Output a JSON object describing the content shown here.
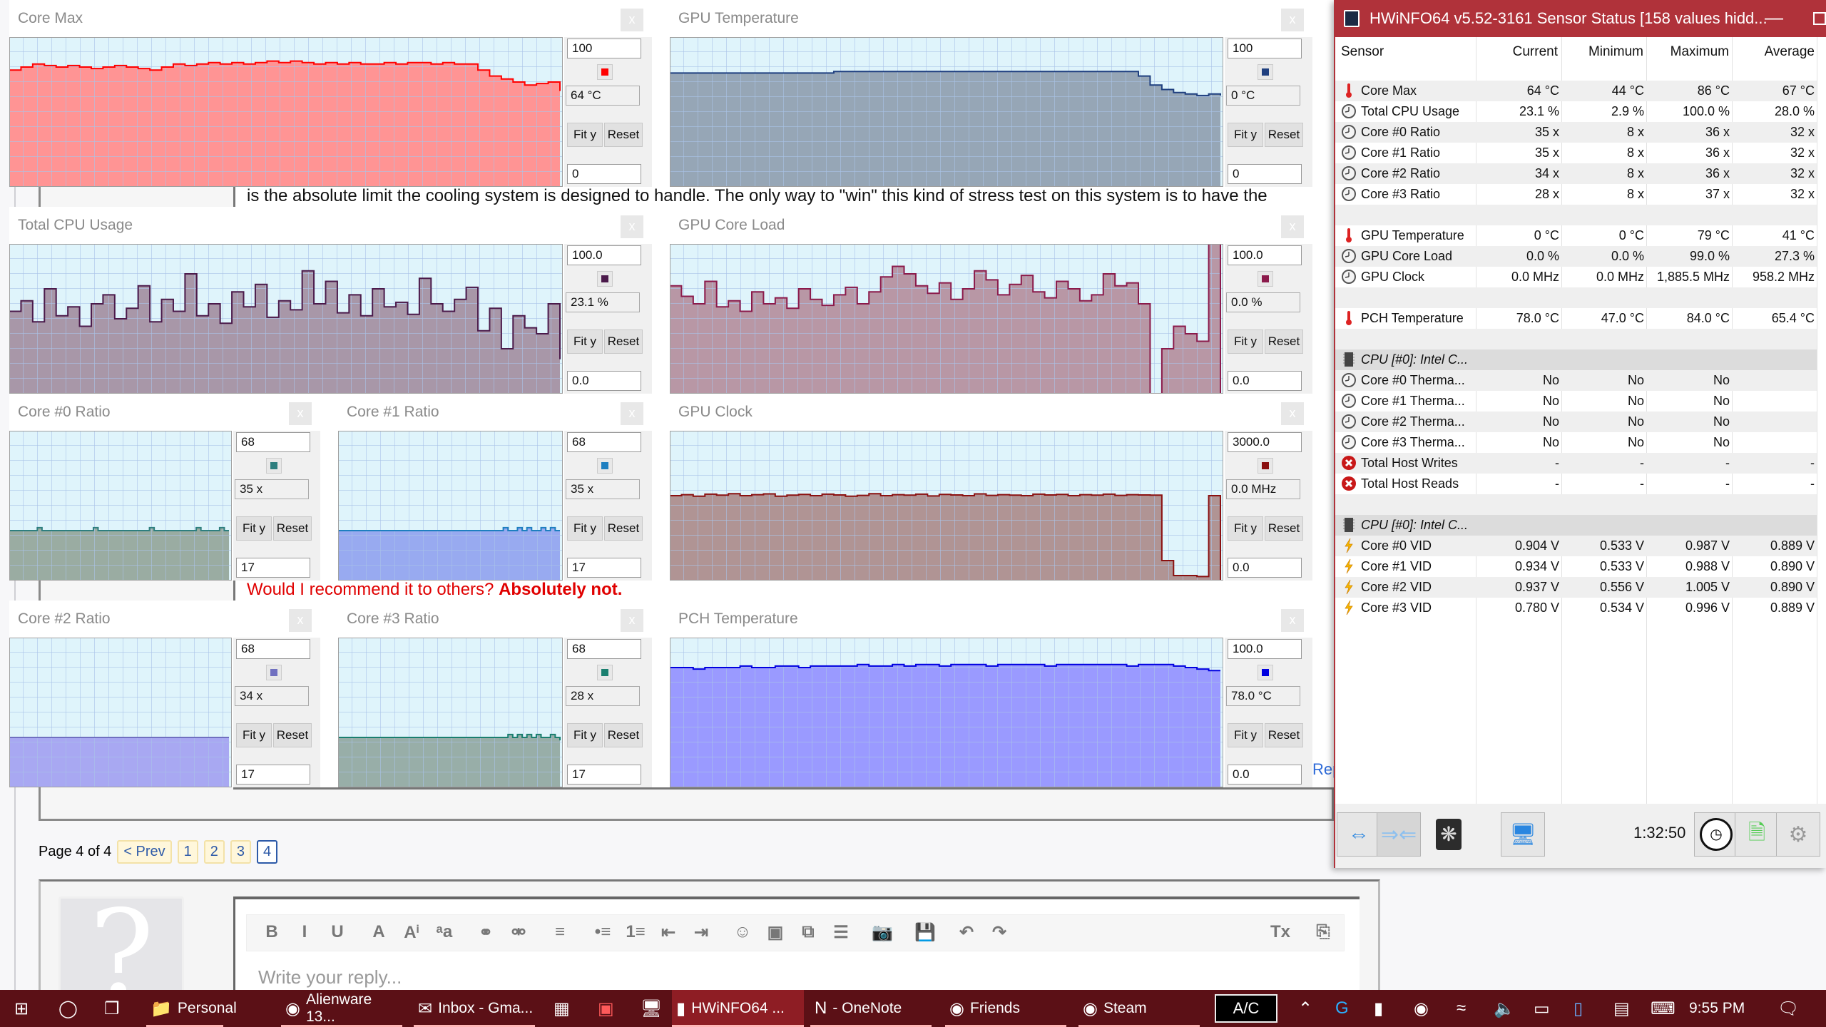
{
  "forum": {
    "line_partial": "is the absolute limit the cooling system is designed to handle. The only way to \"win\" this kind of stress test on this system is to have the",
    "recommend_prefix": "Would I recommend it to others? ",
    "recommend_bold": "Absolutely not.",
    "report_link": "Rep",
    "paging": {
      "label": "Page 4 of 4",
      "prev": "< Prev",
      "pages": [
        "1",
        "2",
        "3",
        "4"
      ],
      "current": "4"
    },
    "reply_placeholder": "Write your reply...",
    "avatar_glyph": "?",
    "editor_tools": [
      "B",
      "I",
      "U",
      "A",
      "Aⁱ",
      "ᵃa",
      "⚭",
      "⚮",
      "≡",
      "•≡",
      "1≡",
      "⇤",
      "⇥",
      "☺",
      "▣",
      "⧉",
      "☰",
      "📷",
      "💾",
      "↶",
      "↷",
      "Tx",
      "⎘"
    ]
  },
  "graph_common": {
    "fit_label": "Fit y",
    "reset_label": "Reset",
    "close_label": "x"
  },
  "graphs": [
    {
      "title": "Core Max",
      "max": "100",
      "min": "0",
      "current": "64 °C",
      "ymin": 0,
      "ymax": 100,
      "fill": "#ff9494",
      "line": "#ff0000",
      "values": [
        78,
        80,
        82,
        81,
        80,
        81,
        80,
        79,
        80,
        81,
        80,
        79,
        78,
        80,
        82,
        81,
        82,
        83,
        82,
        83,
        82,
        83,
        84,
        83,
        84,
        83,
        82,
        83,
        82,
        83,
        82,
        82,
        83,
        82,
        83,
        83,
        82,
        83,
        82,
        82,
        78,
        74,
        72,
        70,
        68,
        69,
        70,
        64
      ]
    },
    {
      "title": "GPU Temperature",
      "max": "100",
      "min": "0",
      "current": "0 °C",
      "ymin": 0,
      "ymax": 100,
      "fill": "#96a6b6",
      "line": "#1f3f7f",
      "values": [
        76,
        76,
        76,
        76,
        76,
        76,
        76,
        76,
        76,
        76,
        76,
        76,
        76,
        76,
        77,
        77,
        77,
        77,
        77,
        77,
        77,
        77,
        77,
        77,
        77,
        77,
        77,
        77,
        77,
        77,
        77,
        77,
        77,
        77,
        77,
        77,
        77,
        77,
        77,
        77,
        74,
        68,
        65,
        63,
        62,
        61,
        62,
        61
      ]
    },
    {
      "title": "Total CPU Usage",
      "max": "100.0",
      "min": "0.0",
      "current": "23.1 %",
      "ymin": 0,
      "ymax": 100,
      "fill": "#a897a8",
      "line": "#4b1a4b",
      "values": [
        55,
        62,
        48,
        70,
        52,
        58,
        45,
        60,
        66,
        50,
        57,
        72,
        48,
        63,
        55,
        80,
        52,
        60,
        47,
        68,
        58,
        73,
        51,
        62,
        56,
        82,
        60,
        75,
        54,
        66,
        52,
        70,
        58,
        61,
        53,
        77,
        60,
        55,
        63,
        71,
        42,
        57,
        30,
        52,
        44,
        40,
        60,
        23
      ]
    },
    {
      "title": "GPU Core Load",
      "max": "100.0",
      "min": "0.0",
      "current": "0.0 %",
      "ymin": 0,
      "ymax": 100,
      "fill": "#b897a5",
      "line": "#8b1a4b",
      "values": [
        72,
        65,
        60,
        75,
        58,
        62,
        55,
        68,
        60,
        64,
        57,
        70,
        63,
        59,
        66,
        71,
        60,
        68,
        78,
        85,
        80,
        72,
        67,
        74,
        63,
        70,
        82,
        76,
        66,
        73,
        79,
        68,
        64,
        75,
        70,
        62,
        66,
        80,
        72,
        74,
        60,
        0,
        30,
        45,
        40,
        35,
        100,
        0
      ]
    },
    {
      "title": "Core #0 Ratio",
      "max": "68",
      "min": "17",
      "current": "35 x",
      "ymin": 17,
      "ymax": 68,
      "fill": "#9aaca2",
      "line": "#2e7f7f",
      "values": [
        34,
        34,
        34,
        34,
        34,
        34,
        35,
        34,
        34,
        34,
        34,
        34,
        34,
        34,
        34,
        34,
        34,
        34,
        35,
        34,
        34,
        34,
        34,
        34,
        34,
        34,
        34,
        34,
        34,
        34,
        35,
        34,
        34,
        34,
        34,
        34,
        34,
        34,
        34,
        34,
        35,
        34,
        34,
        34,
        34,
        35,
        34,
        34
      ]
    },
    {
      "title": "Core #1 Ratio",
      "max": "68",
      "min": "17",
      "current": "35 x",
      "ymin": 17,
      "ymax": 68,
      "fill": "#98aaf0",
      "line": "#1e7fc0",
      "values": [
        34,
        34,
        34,
        34,
        34,
        34,
        34,
        34,
        34,
        34,
        34,
        34,
        34,
        34,
        34,
        34,
        34,
        34,
        34,
        34,
        34,
        34,
        34,
        34,
        34,
        34,
        34,
        34,
        34,
        34,
        34,
        34,
        34,
        34,
        34,
        35,
        34,
        34,
        35,
        34,
        35,
        34,
        34,
        35,
        34,
        35,
        34,
        34
      ]
    },
    {
      "title": "GPU Clock",
      "max": "3000.0",
      "min": "0.0",
      "current": "0.0 MHz",
      "ymin": 0,
      "ymax": 3000,
      "fill": "#b09494",
      "line": "#8b1010",
      "values": [
        1700,
        1720,
        1690,
        1730,
        1710,
        1740,
        1700,
        1720,
        1735,
        1690,
        1710,
        1725,
        1700,
        1730,
        1715,
        1690,
        1705,
        1740,
        1700,
        1720,
        1710,
        1730,
        1695,
        1725,
        1715,
        1700,
        1735,
        1705,
        1720,
        1710,
        1700,
        1730,
        1715,
        1725,
        1700,
        1720,
        1710,
        1730,
        1705,
        1720,
        1715,
        1710,
        400,
        100,
        100,
        80,
        1700,
        0
      ]
    },
    {
      "title": "Core #2 Ratio",
      "max": "68",
      "min": "17",
      "current": "34 x",
      "ymin": 17,
      "ymax": 68,
      "fill": "#a8a8f2",
      "line": "#7070c0",
      "values": [
        34,
        34,
        34,
        34,
        34,
        34,
        34,
        34,
        34,
        34,
        34,
        34,
        34,
        34,
        34,
        34,
        34,
        34,
        34,
        34,
        34,
        34,
        34,
        34,
        34,
        34,
        34,
        34,
        34,
        34,
        34,
        34,
        34,
        34,
        34,
        34,
        34,
        34,
        34,
        34,
        34,
        34,
        34,
        34,
        34,
        34,
        34,
        34
      ]
    },
    {
      "title": "Core #3 Ratio",
      "max": "68",
      "min": "17",
      "current": "28 x",
      "ymin": 17,
      "ymax": 68,
      "fill": "#98aea8",
      "line": "#1a7f6f",
      "values": [
        34,
        34,
        34,
        34,
        34,
        34,
        34,
        34,
        34,
        34,
        34,
        34,
        34,
        34,
        34,
        34,
        34,
        34,
        34,
        34,
        34,
        34,
        34,
        34,
        34,
        34,
        34,
        34,
        34,
        34,
        34,
        34,
        34,
        34,
        34,
        34,
        35,
        34,
        35,
        34,
        35,
        34,
        35,
        34,
        34,
        35,
        34,
        33
      ]
    },
    {
      "title": "PCH Temperature",
      "max": "100.0",
      "min": "0.0",
      "current": "78.0 °C",
      "ymin": 0,
      "ymax": 100,
      "fill": "#9a9aff",
      "line": "#0000e0",
      "values": [
        80,
        80,
        79,
        80,
        80,
        80,
        81,
        80,
        80,
        81,
        81,
        80,
        81,
        81,
        81,
        81,
        82,
        81,
        81,
        82,
        81,
        82,
        82,
        81,
        82,
        82,
        82,
        81,
        82,
        82,
        82,
        82,
        81,
        82,
        82,
        82,
        82,
        82,
        82,
        81,
        82,
        82,
        82,
        81,
        80,
        79,
        78,
        78
      ]
    }
  ],
  "hwinfo": {
    "title": "HWiNFO64 v5.52-3161 Sensor Status [158 values hidd...",
    "columns": [
      "Sensor",
      "Current",
      "Minimum",
      "Maximum",
      "Average"
    ],
    "rows": [
      {
        "icon": "blank"
      },
      {
        "icon": "thermometer",
        "name": "Core Max",
        "cur": "64 °C",
        "min": "44 °C",
        "max": "86 °C",
        "avg": "67 °C"
      },
      {
        "icon": "clock",
        "name": "Total CPU Usage",
        "cur": "23.1 %",
        "min": "2.9 %",
        "max": "100.0 %",
        "avg": "28.0 %"
      },
      {
        "icon": "clock",
        "name": "Core #0 Ratio",
        "cur": "35 x",
        "min": "8 x",
        "max": "36 x",
        "avg": "32 x"
      },
      {
        "icon": "clock",
        "name": "Core #1 Ratio",
        "cur": "35 x",
        "min": "8 x",
        "max": "36 x",
        "avg": "32 x"
      },
      {
        "icon": "clock",
        "name": "Core #2 Ratio",
        "cur": "34 x",
        "min": "8 x",
        "max": "36 x",
        "avg": "32 x"
      },
      {
        "icon": "clock",
        "name": "Core #3 Ratio",
        "cur": "28 x",
        "min": "8 x",
        "max": "37 x",
        "avg": "32 x"
      },
      {
        "icon": "blank"
      },
      {
        "icon": "thermometer",
        "name": "GPU Temperature",
        "cur": "0 °C",
        "min": "0 °C",
        "max": "79 °C",
        "avg": "41 °C"
      },
      {
        "icon": "clock",
        "name": "GPU Core Load",
        "cur": "0.0 %",
        "min": "0.0 %",
        "max": "99.0 %",
        "avg": "27.3 %"
      },
      {
        "icon": "clock",
        "name": "GPU Clock",
        "cur": "0.0 MHz",
        "min": "0.0 MHz",
        "max": "1,885.5 MHz",
        "avg": "958.2 MHz"
      },
      {
        "icon": "blank"
      },
      {
        "icon": "thermometer",
        "name": "PCH Temperature",
        "cur": "78.0 °C",
        "min": "47.0 °C",
        "max": "84.0 °C",
        "avg": "65.4 °C"
      },
      {
        "icon": "blank"
      },
      {
        "icon": "chip",
        "name": "CPU [#0]: Intel C...",
        "group": true
      },
      {
        "icon": "clock",
        "name": "Core #0 Therma...",
        "cur": "No",
        "min": "No",
        "max": "No",
        "avg": ""
      },
      {
        "icon": "clock",
        "name": "Core #1 Therma...",
        "cur": "No",
        "min": "No",
        "max": "No",
        "avg": ""
      },
      {
        "icon": "clock",
        "name": "Core #2 Therma...",
        "cur": "No",
        "min": "No",
        "max": "No",
        "avg": ""
      },
      {
        "icon": "clock",
        "name": "Core #3 Therma...",
        "cur": "No",
        "min": "No",
        "max": "No",
        "avg": ""
      },
      {
        "icon": "error",
        "name": "Total Host Writes",
        "cur": "-",
        "min": "-",
        "max": "-",
        "avg": "-"
      },
      {
        "icon": "error",
        "name": "Total Host Reads",
        "cur": "-",
        "min": "-",
        "max": "-",
        "avg": "-"
      },
      {
        "icon": "blank"
      },
      {
        "icon": "chip",
        "name": "CPU [#0]: Intel C...",
        "group": true
      },
      {
        "icon": "bolt",
        "name": "Core #0 VID",
        "cur": "0.904 V",
        "min": "0.533 V",
        "max": "0.987 V",
        "avg": "0.889 V"
      },
      {
        "icon": "bolt",
        "name": "Core #1 VID",
        "cur": "0.934 V",
        "min": "0.533 V",
        "max": "0.988 V",
        "avg": "0.890 V"
      },
      {
        "icon": "bolt",
        "name": "Core #2 VID",
        "cur": "0.937 V",
        "min": "0.556 V",
        "max": "1.005 V",
        "avg": "0.890 V"
      },
      {
        "icon": "bolt",
        "name": "Core #3 VID",
        "cur": "0.780 V",
        "min": "0.534 V",
        "max": "0.996 V",
        "avg": "0.889 V"
      }
    ],
    "elapsed": "1:32:50"
  },
  "taskbar": {
    "items": [
      {
        "label": "Personal",
        "icon": "folder-icon"
      },
      {
        "label": "Alienware 13...",
        "icon": "chrome-icon"
      },
      {
        "label": "Inbox - Gma...",
        "icon": "mail-icon"
      },
      {
        "label": "HWiNFO64 ...",
        "icon": "hwinfo-icon"
      },
      {
        "label": "- OneNote",
        "icon": "onenote-icon"
      },
      {
        "label": "Friends",
        "icon": "steam-icon"
      },
      {
        "label": "Steam",
        "icon": "steam-icon"
      }
    ],
    "ac_label": "A/C",
    "clock": "9:55 PM"
  }
}
